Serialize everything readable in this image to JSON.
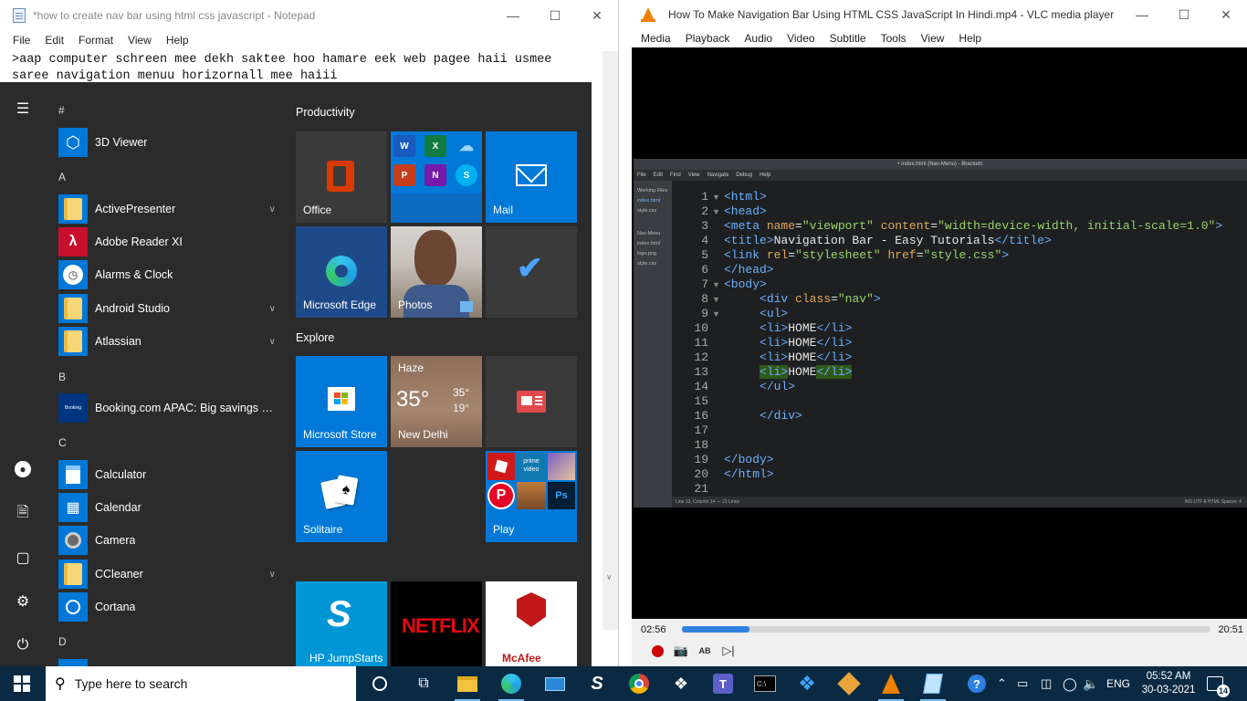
{
  "notepad": {
    "title": "*how to create nav bar using html css javascript - Notepad",
    "menu": [
      "File",
      "Edit",
      "Format",
      "View",
      "Help"
    ],
    "line1": ">aap computer schreen mee dekh saktee hoo hamare eek web pagee haii usmee",
    "line2": "saree navigation menuu horizornall mee haiii"
  },
  "vlc": {
    "title": "How To Make Navigation Bar Using HTML CSS JavaScript In Hindi.mp4 - VLC media player",
    "menu": [
      "Media",
      "Playback",
      "Audio",
      "Video",
      "Subtitle",
      "Tools",
      "View",
      "Help"
    ],
    "elapsed": "02:56",
    "total": "20:51",
    "progress": 0.128
  },
  "brackets": {
    "title": "• index.html (Nav-Menu) - Brackets",
    "menu": [
      "File",
      "Edit",
      "Find",
      "View",
      "Navigate",
      "Debug",
      "Help"
    ],
    "working_files_label": "Working Files",
    "working_files": [
      "index.html",
      "style.css"
    ],
    "project_label": "Nav-Menu",
    "project_files": [
      "index.html",
      "logo.png",
      "style.css"
    ],
    "status_left": "Line 13, Column 14 — 21 Lines",
    "status_right": "INS    UTF-8    HTML    Spaces: 4",
    "line_numbers": [
      "1",
      "2",
      "3",
      "4",
      "5",
      "6",
      "7",
      "8",
      "9",
      "10",
      "11",
      "12",
      "13",
      "14",
      "15",
      "16",
      "17",
      "18",
      "19",
      "20",
      "21"
    ]
  },
  "start": {
    "apps": [
      {
        "letter": "#"
      },
      {
        "label": "3D Viewer"
      },
      {
        "letter": "A"
      },
      {
        "label": "ActivePresenter",
        "expand": true
      },
      {
        "label": "Adobe Reader XI"
      },
      {
        "label": "Alarms & Clock"
      },
      {
        "label": "Android Studio",
        "expand": true
      },
      {
        "label": "Atlassian",
        "expand": true
      },
      {
        "letter": "B"
      },
      {
        "label": "Booking.com APAC: Big savings on h..."
      },
      {
        "letter": "C"
      },
      {
        "label": "Calculator"
      },
      {
        "label": "Calendar"
      },
      {
        "label": "Camera"
      },
      {
        "label": "CCleaner",
        "expand": true
      },
      {
        "label": "Cortana"
      },
      {
        "letter": "D"
      }
    ],
    "group_productivity": "Productivity",
    "group_explore": "Explore",
    "tiles": {
      "office": "Office",
      "mail": "Mail",
      "edge": "Microsoft Edge",
      "photos": "Photos",
      "store": "Microsoft Store",
      "weather_cond": "Haze",
      "weather_temp": "35°",
      "weather_hi": "35°",
      "weather_lo": "19°",
      "weather_city": "New Delhi",
      "solitaire": "Solitaire",
      "play": "Play",
      "hp": "HP JumpStarts",
      "netflix": "NETFLIX",
      "mcafee": "McAfee",
      "booking_icon": "Booking",
      "prime_line1": "prime",
      "prime_line2": "video",
      "ps_icon": "Ps"
    }
  },
  "taskbar": {
    "search_placeholder": "Type here to search",
    "language": "ENG",
    "time": "05:52 AM",
    "date": "30-03-2021",
    "notifications": "14"
  }
}
